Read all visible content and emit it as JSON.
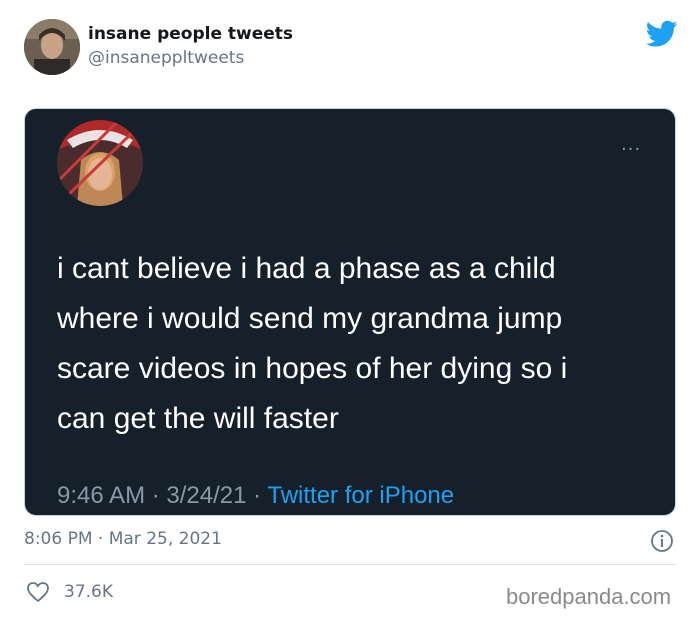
{
  "tweet": {
    "display_name": "insane people tweets",
    "handle": "@insanepp ltweets",
    "timestamp": "8:06 PM · Mar 25, 2021",
    "likes": "37.6K",
    "icons": {
      "brand": "twitter-bird-icon",
      "info": "info-icon",
      "like": "heart-icon"
    }
  },
  "embedded": {
    "more": "···",
    "text_lines": [
      "i cant believe i had a phase as a child",
      "where i would send my grandma jump",
      "scare videos in hopes of her dying so i",
      "can get the will faster"
    ],
    "time": "9:46 AM · 3/24/21 · ",
    "source": "Twitter for iPhone"
  },
  "watermark": "boredpanda.com",
  "colors": {
    "accent": "#1da1f2",
    "card_bg": "#15202b",
    "muted": "#657786"
  }
}
